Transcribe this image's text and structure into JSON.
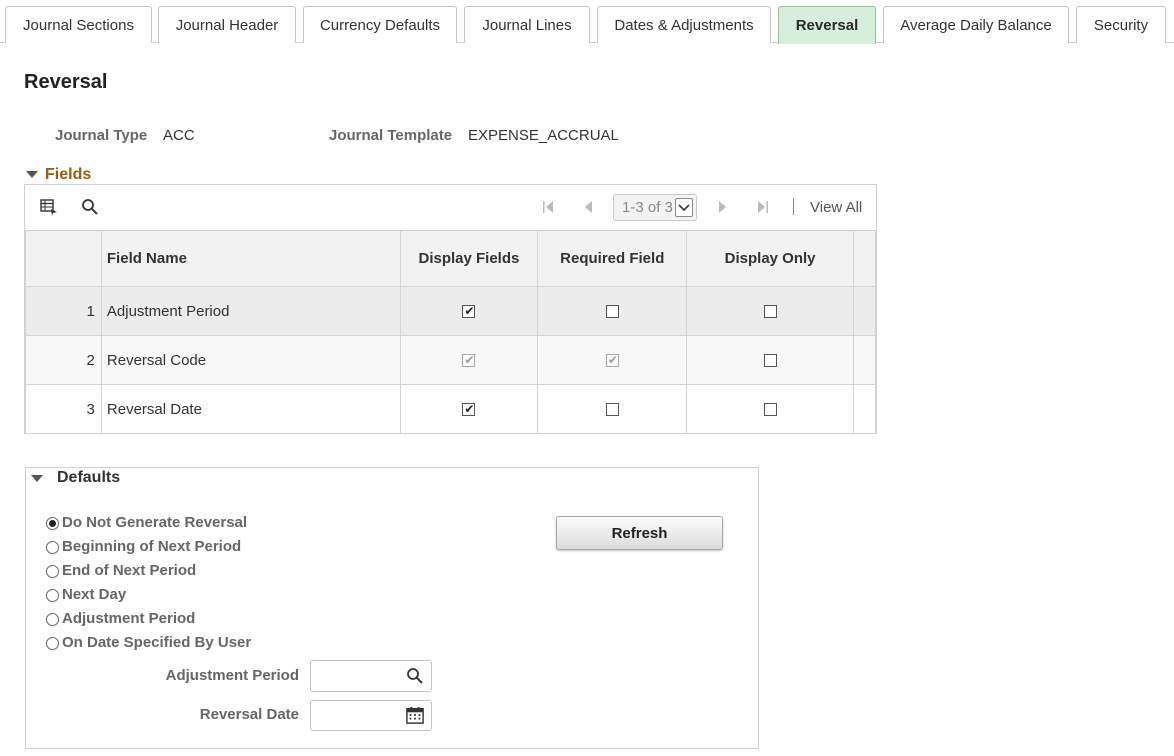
{
  "tabs": [
    {
      "label": "Journal Sections",
      "active": false
    },
    {
      "label": "Journal Header",
      "active": false
    },
    {
      "label": "Currency Defaults",
      "active": false
    },
    {
      "label": "Journal Lines",
      "active": false
    },
    {
      "label": "Dates & Adjustments",
      "active": false
    },
    {
      "label": "Reversal",
      "active": true
    },
    {
      "label": "Average Daily Balance",
      "active": false
    },
    {
      "label": "Security",
      "active": false
    }
  ],
  "page": {
    "title": "Reversal"
  },
  "header": {
    "journal_type_label": "Journal Type",
    "journal_type_value": "ACC",
    "journal_template_label": "Journal Template",
    "journal_template_value": "EXPENSE_ACCRUAL"
  },
  "fields_section": {
    "title": "Fields",
    "pager_text": "1-3 of 3",
    "view_all": "View All",
    "columns": [
      "Field Name",
      "Display Fields",
      "Required Field",
      "Display Only"
    ],
    "rows": [
      {
        "num": "1",
        "field_name": "Adjustment Period",
        "display_fields": true,
        "display_fields_disabled": false,
        "required_field": false,
        "required_field_disabled": false,
        "display_only": false
      },
      {
        "num": "2",
        "field_name": "Reversal Code",
        "display_fields": true,
        "display_fields_disabled": true,
        "required_field": true,
        "required_field_disabled": true,
        "display_only": false
      },
      {
        "num": "3",
        "field_name": "Reversal Date",
        "display_fields": true,
        "display_fields_disabled": false,
        "required_field": false,
        "required_field_disabled": false,
        "display_only": false
      }
    ]
  },
  "defaults_section": {
    "title": "Defaults",
    "options": [
      {
        "label": "Do Not Generate Reversal",
        "selected": true
      },
      {
        "label": "Beginning of Next Period",
        "selected": false
      },
      {
        "label": "End of Next Period",
        "selected": false
      },
      {
        "label": "Next Day",
        "selected": false
      },
      {
        "label": "Adjustment Period",
        "selected": false
      },
      {
        "label": "On Date Specified By User",
        "selected": false
      }
    ],
    "refresh_label": "Refresh",
    "adjustment_period_label": "Adjustment Period",
    "adjustment_period_value": "",
    "reversal_date_label": "Reversal Date",
    "reversal_date_value": ""
  },
  "colors": {
    "active_tab": "#d6eedb",
    "section_title": "#9a5a12"
  },
  "icons": [
    "grid-personalize-icon",
    "find-icon",
    "first-page-icon",
    "previous-icon",
    "next-icon",
    "last-page-icon",
    "dropdown-icon",
    "lookup-icon",
    "calendar-icon"
  ]
}
